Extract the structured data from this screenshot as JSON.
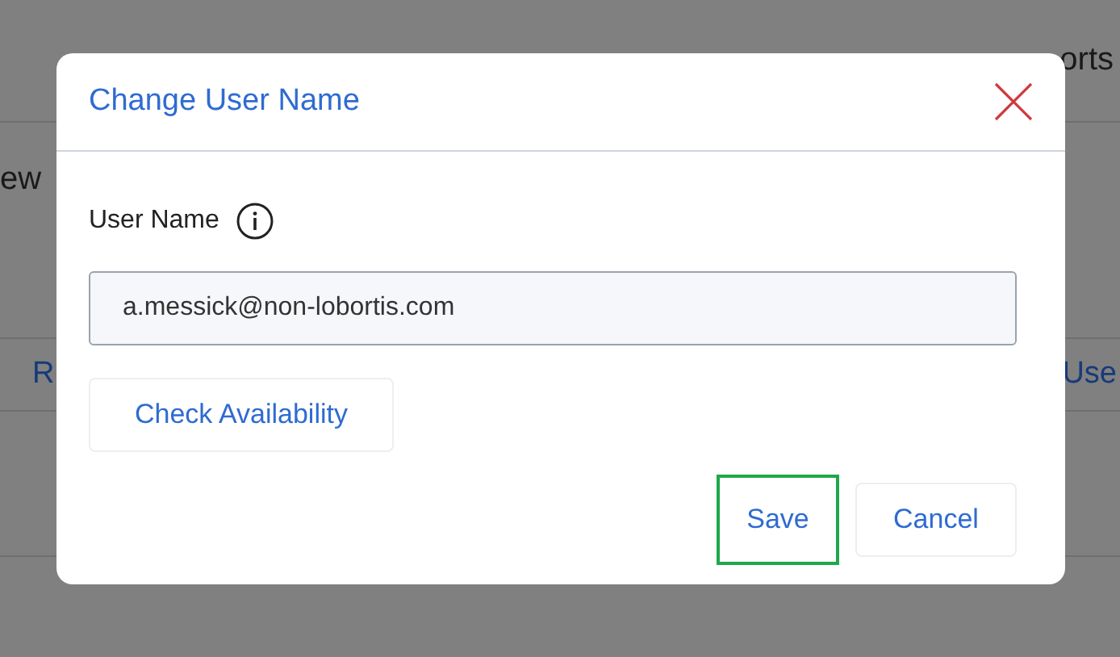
{
  "background": {
    "nav_fragment": "orts",
    "text_fragment": "ew",
    "row_fragments": [
      "R",
      "Use"
    ]
  },
  "dialog": {
    "title": "Change User Name",
    "field": {
      "label": "User Name",
      "value": "a.messick@non-lobortis.com"
    },
    "check_button": "Check Availability",
    "buttons": [
      {
        "label": "Save",
        "focused": true
      },
      {
        "label": "Cancel",
        "focused": false
      }
    ]
  }
}
